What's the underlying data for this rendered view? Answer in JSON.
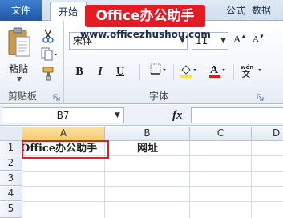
{
  "tabs": {
    "file": "文件",
    "home": "开始",
    "formula": "公式",
    "data": "数据"
  },
  "watermark": {
    "title": "Office办公助手",
    "url": "www.officezhushou.com"
  },
  "clipboard": {
    "paste_label": "粘贴",
    "group_label": "剪贴板"
  },
  "font": {
    "name": "宋体",
    "size": "11",
    "group_label": "字体",
    "font_color": "#e01b1b",
    "fill_color": "#f7e33b"
  },
  "formula_bar": {
    "name_box": "B7",
    "fx_label": "fx",
    "formula": ""
  },
  "sheet": {
    "columns": [
      "A",
      "B",
      "C",
      "D"
    ],
    "rows": [
      "1",
      "2",
      "3",
      "4",
      "5"
    ],
    "cells": {
      "A1": "Office办公助手",
      "B1": "网址"
    },
    "highlight_color": "#e81c24",
    "selected_column_color": "#f4c96c"
  }
}
